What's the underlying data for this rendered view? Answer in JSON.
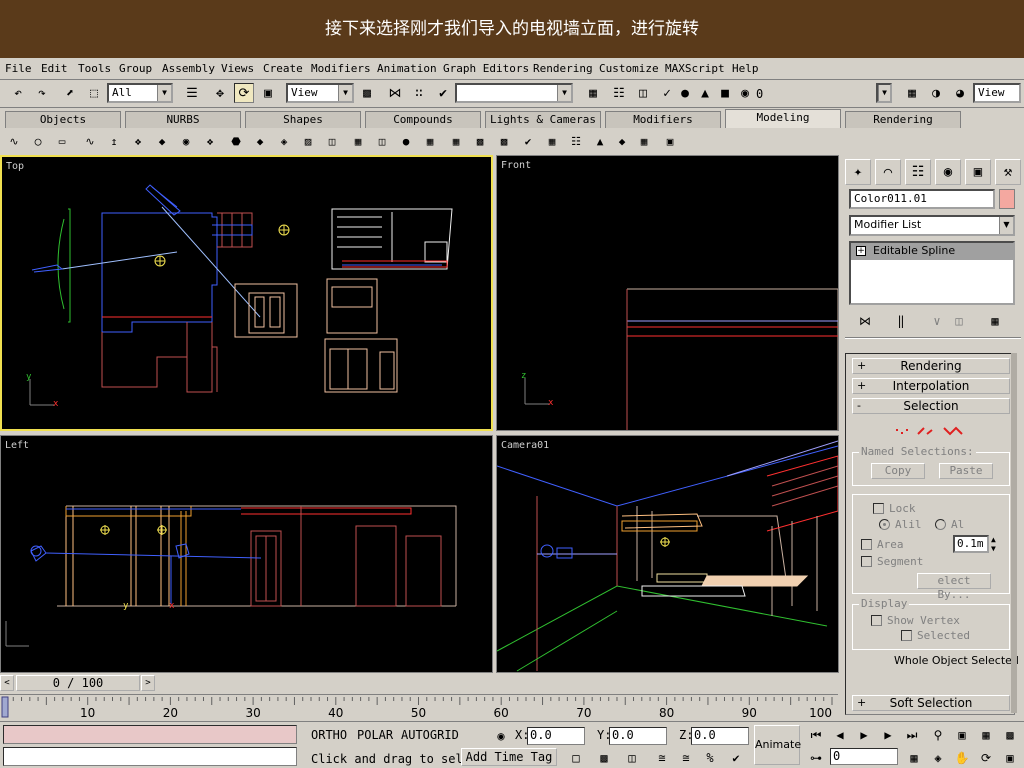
{
  "caption": "接下来选择刚才我们导入的电视墙立面，进行旋转",
  "menu": [
    "File",
    "Edit",
    "Tools",
    "Group",
    "Assembly",
    "Views",
    "Create",
    "Modifiers",
    "Animation",
    "Graph Editors",
    "Rendering",
    "Customize",
    "MAXScript",
    "Help"
  ],
  "toolbar": {
    "selection_filter": "All",
    "ref_coord": "View",
    "named_selection": "",
    "layer_value": "0",
    "render_view": "View"
  },
  "tabs": [
    "Objects",
    "NURBS",
    "Shapes",
    "Compounds",
    "Lights & Cameras",
    "Modifiers",
    "Modeling",
    "Rendering"
  ],
  "active_tab": "Modeling",
  "viewports": {
    "top": "Top",
    "front": "Front",
    "left": "Left",
    "camera": "Camera01"
  },
  "command_panel": {
    "object_name": "Color011.01",
    "object_color": "#f4a8a0",
    "modifier_list": "Modifier List",
    "stack_item": "Editable Spline",
    "rollouts": {
      "rendering": "Rendering",
      "interpolation": "Interpolation",
      "selection": "Selection",
      "soft_selection": "Soft Selection"
    },
    "rollout_signs": {
      "plus": "+",
      "minus": "-"
    },
    "named_selections": {
      "title": "Named Selections:",
      "copy": "Copy",
      "paste": "Paste"
    },
    "lock": "Lock",
    "alil": "Alil",
    "al": "Al",
    "area": "Area",
    "area_value": "0.1m",
    "segment": "Segment",
    "select_by": "elect By...",
    "display": {
      "title": "Display",
      "show_vertex": "Show Vertex",
      "selected": "Selected"
    },
    "status": "Whole Object Selected"
  },
  "time": {
    "slider": "0 / 100",
    "ticks": [
      "10",
      "20",
      "30",
      "40",
      "50",
      "60",
      "70",
      "80",
      "90",
      "100"
    ]
  },
  "status": {
    "snaps": [
      "ORTHO",
      "POLAR",
      "AUTOGRID"
    ],
    "prompt": "Click and drag to sel",
    "add_time_tag": "Add Time Tag",
    "x_label": "X:",
    "y_label": "Y:",
    "z_label": "Z:",
    "x": "0.0",
    "y": "0.0",
    "z": "0.0",
    "animate": "Animate",
    "frame": "0"
  }
}
